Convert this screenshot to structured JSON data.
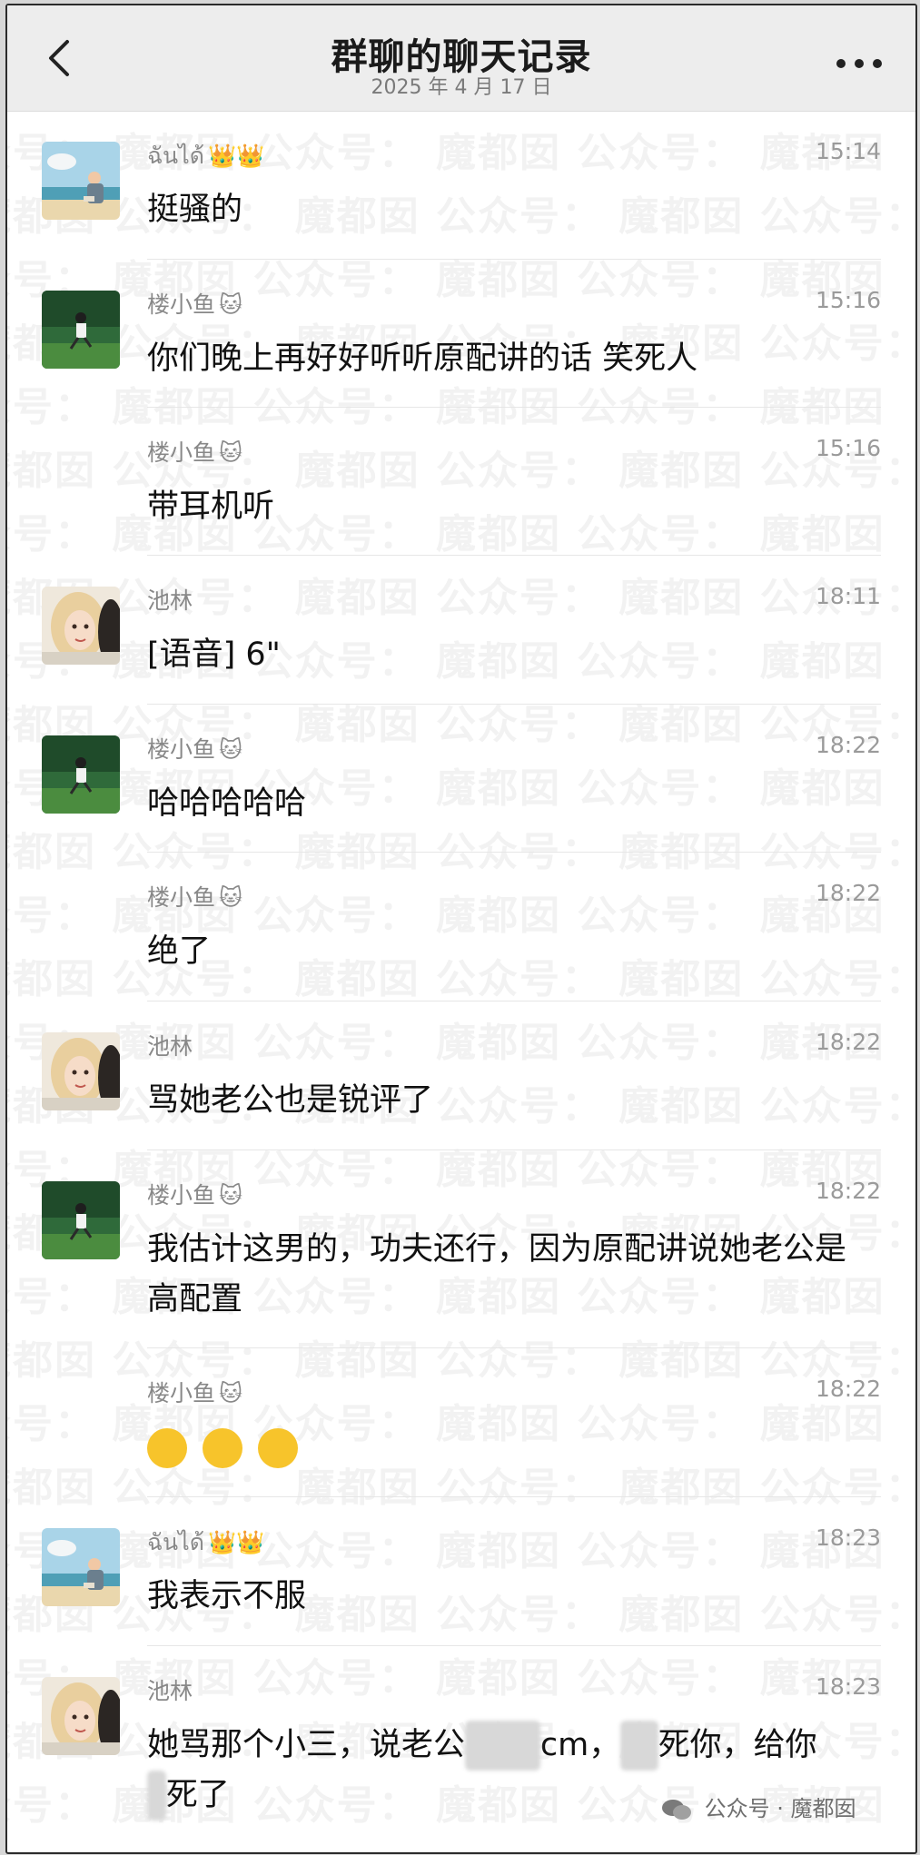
{
  "header": {
    "title": "群聊的聊天记录",
    "subtitle": "2025 年 4 月 17 日"
  },
  "watermark": {
    "line_a": "众号：   魔都囡   公众号：   魔都囡   公众号：   魔都囡",
    "line_b": "魔都囡   公众号：   魔都囡   公众号：   魔都囡   公众号："
  },
  "messages": [
    {
      "avatar": "beach-reading-girl",
      "name": "ฉันได้",
      "badge": "👑👑",
      "time": "15:14",
      "text": "挺骚的"
    },
    {
      "avatar": "running-girl-grass",
      "name": "楼小鱼",
      "badge": "🐱",
      "time": "15:16",
      "text": "你们晚上再好好听听原配讲的话 笑死人"
    },
    {
      "avatar": "",
      "name": "楼小鱼",
      "badge": "🐱",
      "time": "15:16",
      "text": "带耳机听"
    },
    {
      "avatar": "blonde-woman-illustration",
      "name": "池林",
      "badge": "",
      "time": "18:11",
      "text": "[语音] 6\""
    },
    {
      "avatar": "running-girl-grass",
      "name": "楼小鱼",
      "badge": "🐱",
      "time": "18:22",
      "text": "哈哈哈哈哈"
    },
    {
      "avatar": "",
      "name": "楼小鱼",
      "badge": "🐱",
      "time": "18:22",
      "text": "绝了"
    },
    {
      "avatar": "blonde-woman-illustration",
      "name": "池林",
      "badge": "",
      "time": "18:22",
      "text": "骂她老公也是锐评了"
    },
    {
      "avatar": "running-girl-grass",
      "name": "楼小鱼",
      "badge": "🐱",
      "time": "18:22",
      "text": "我估计这男的，功夫还行，因为原配讲说她老公是高配置"
    },
    {
      "avatar": "",
      "name": "楼小鱼",
      "badge": "🐱",
      "time": "18:22",
      "text": ""
    },
    {
      "avatar": "beach-reading-girl",
      "name": "ฉันได้",
      "badge": "👑👑",
      "time": "18:23",
      "text": "我表示不服"
    },
    {
      "avatar": "blonde-woman-illustration",
      "name": "池林",
      "badge": "",
      "time": "18:23",
      "text_parts": [
        "她骂那个小三，说老公",
        "cm，",
        "死你，给你",
        "死了"
      ]
    }
  ],
  "footer": {
    "logo_text": "公众号 · 魔都囡"
  },
  "colors": {
    "header_bg": "#ededed",
    "text": "#111111",
    "meta": "#888888"
  }
}
